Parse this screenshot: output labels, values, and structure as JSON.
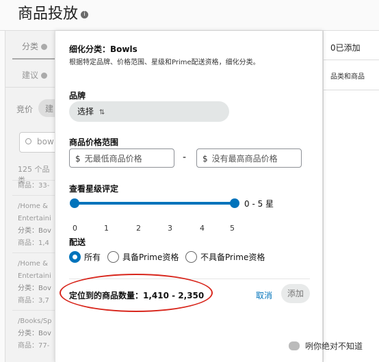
{
  "page": {
    "title": "商品投放",
    "info_icon": "info-icon"
  },
  "background": {
    "tab_category": "分类",
    "suggest_label": "建议",
    "bid_label": "竞价",
    "bid_pill": "建",
    "search_value": "bow",
    "result_count": "125 个品类",
    "items": [
      {
        "path": "",
        "category": "",
        "items_label": "商品：33-"
      },
      {
        "path": "/Home &",
        "path2": "Entertaini",
        "category": "分类：Bov",
        "items_label": "商品：1,4"
      },
      {
        "path": "/Home &",
        "path2": "Entertaini",
        "category": "分类：Bov",
        "items_label": "商品：3,7"
      },
      {
        "path": "/Books/Sp",
        "path2": "",
        "category": "分类：Bov",
        "items_label": "商品：77-"
      }
    ],
    "right_added": "0已添加",
    "right_category": "品类和商品"
  },
  "popover": {
    "title": "细化分类：Bowls",
    "subtitle": "根据特定品牌、价格范围、星级和Prime配送资格，细化分类。",
    "brand_label": "品牌",
    "brand_select": "选择",
    "price_label": "商品价格范围",
    "currency": "$",
    "min_placeholder": "无最低商品价格",
    "max_placeholder": "没有最高商品价格",
    "price_separator": "-",
    "rating_label": "查看星级评定",
    "rating_range": "0 - 5 星",
    "rating_min": 0,
    "rating_max": 5,
    "ticks": [
      "0",
      "1",
      "2",
      "3",
      "4",
      "5"
    ],
    "shipping_label": "配送",
    "shipping_options": [
      "所有",
      "具备Prime资格",
      "不具备Prime资格"
    ],
    "shipping_selected": "所有",
    "found_text": "定位到的商品数量：1,410 - 2,350",
    "cancel_label": "取消",
    "add_label": "添加"
  },
  "watermark": "咧你绝对不知道",
  "colors": {
    "accent": "#0073bb",
    "annotation": "#d8261c"
  }
}
